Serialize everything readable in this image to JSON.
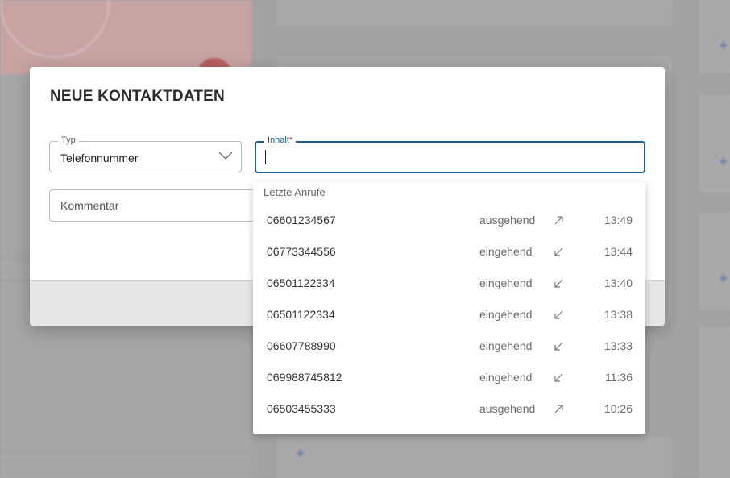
{
  "dialog": {
    "title": "NEUE KONTAKTDATEN",
    "typ_label": "Typ",
    "typ_value": "Telefonnummer",
    "inhalt_label": "Inhalt",
    "inhalt_required_mark": "*",
    "inhalt_value": "",
    "kommentar_placeholder": "Kommentar"
  },
  "recent_calls": {
    "header": "Letzte Anrufe",
    "items": [
      {
        "number": "06601234567",
        "direction": "ausgehend",
        "icon": "outgoing-arrow-icon",
        "time": "13:49"
      },
      {
        "number": "06773344556",
        "direction": "eingehend",
        "icon": "incoming-arrow-icon",
        "time": "13:44"
      },
      {
        "number": "06501122334",
        "direction": "eingehend",
        "icon": "incoming-arrow-icon",
        "time": "13:40"
      },
      {
        "number": "06501122334",
        "direction": "eingehend",
        "icon": "incoming-arrow-icon",
        "time": "13:38"
      },
      {
        "number": "06607788990",
        "direction": "eingehend",
        "icon": "incoming-arrow-icon",
        "time": "13:33"
      },
      {
        "number": "069988745812",
        "direction": "eingehend",
        "icon": "incoming-arrow-icon",
        "time": "11:36"
      },
      {
        "number": "06503455333",
        "direction": "ausgehend",
        "icon": "outgoing-arrow-icon",
        "time": "10:26"
      }
    ]
  },
  "colors": {
    "accent": "#1b5e8c",
    "required": "#c0392b",
    "overlay": "#9b9b9b"
  }
}
